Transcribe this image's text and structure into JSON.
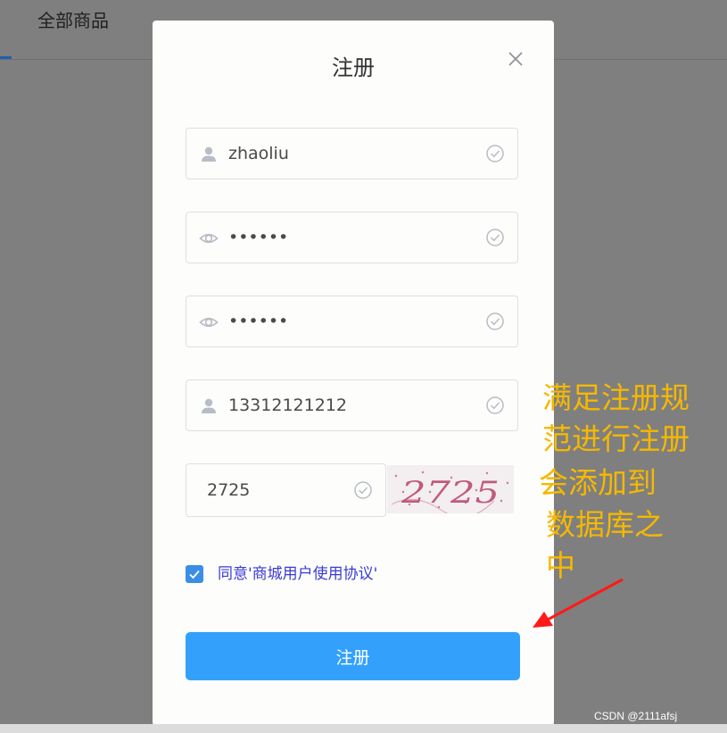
{
  "background": {
    "nav_tab_label": "全部商品"
  },
  "dialog": {
    "title": "注册",
    "fields": [
      {
        "name": "username",
        "value": "zhaoliu",
        "icon": "user-icon",
        "status_icon": "check-circle-icon"
      },
      {
        "name": "password",
        "value": "••••••",
        "icon": "eye-icon",
        "status_icon": "check-circle-icon"
      },
      {
        "name": "confirm-password",
        "value": "••••••",
        "icon": "eye-icon",
        "status_icon": "check-circle-icon"
      },
      {
        "name": "phone",
        "value": "13312121212",
        "icon": "user-icon",
        "status_icon": "check-circle-icon"
      }
    ],
    "captcha": {
      "value": "2725",
      "image_text": "2725"
    },
    "agreement": {
      "checked": true,
      "label": "同意'商城用户使用协议'"
    },
    "submit_label": "注册"
  },
  "annotation": {
    "lines": [
      "满足注册规",
      "范进行注册",
      " 会添加到",
      "数据库之",
      "中"
    ],
    "color": "#f5b800",
    "arrow_color": "#ff1a1a"
  },
  "watermark": "CSDN @2111afsj",
  "colors": {
    "primary_button": "#33a1fc",
    "checkbox": "#3a8ee6",
    "overlay": "#7f7f7f",
    "agreement_text": "#3b3bd6"
  }
}
